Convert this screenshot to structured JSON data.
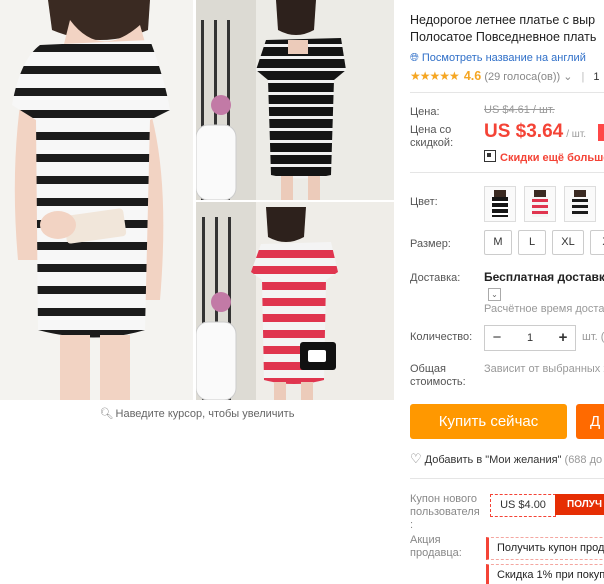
{
  "gallery": {
    "zoom_hint": "Наведите курсор, чтобы увеличить"
  },
  "product": {
    "title_line1": "Недорогое летнее платье с выр",
    "title_line2": "Полосатое Повседневное плать",
    "translate_link": "Посмотреть название на англий",
    "rating": {
      "stars": "★★★★★",
      "score": "4.6",
      "votes": "(29 голоса(ов))",
      "more": "1"
    },
    "price": {
      "label": "Цена:",
      "old": "US $4.61 / шт.",
      "discount_label": "Цена со скидкой:",
      "new": "US $3.64",
      "unit": "/ шт.",
      "promo": "Скидки ещё больше"
    },
    "color": {
      "label": "Цвет:"
    },
    "size": {
      "label": "Размер:",
      "options": [
        "M",
        "L",
        "XL",
        "X"
      ]
    },
    "shipping": {
      "label": "Доставка:",
      "value": "Бесплатная доставка в",
      "time": "Расчётное время доставки"
    },
    "quantity": {
      "label": "Количество:",
      "value": "1",
      "unit": "шт. ("
    },
    "total": {
      "label": "Общая стоимость:",
      "value": "Зависит от выбранных х"
    },
    "buttons": {
      "buy": "Купить сейчас",
      "cart": "Д"
    },
    "wishlist": {
      "text": "Добавить в \"Мои желания\"",
      "count": "(688 до"
    },
    "coupon": {
      "label": "Купон нового пользователя :",
      "amount": "US $4.00",
      "get": "ПОЛУЧ"
    },
    "seller_promo": {
      "label": "Акция продавца:",
      "items": [
        "Получить купон прод",
        "Скидка 1% при покуп"
      ]
    }
  },
  "colors": {
    "accent": "#ff9800",
    "price": "#f44336",
    "link": "#2f6fc8",
    "stars": "#f5a623"
  }
}
